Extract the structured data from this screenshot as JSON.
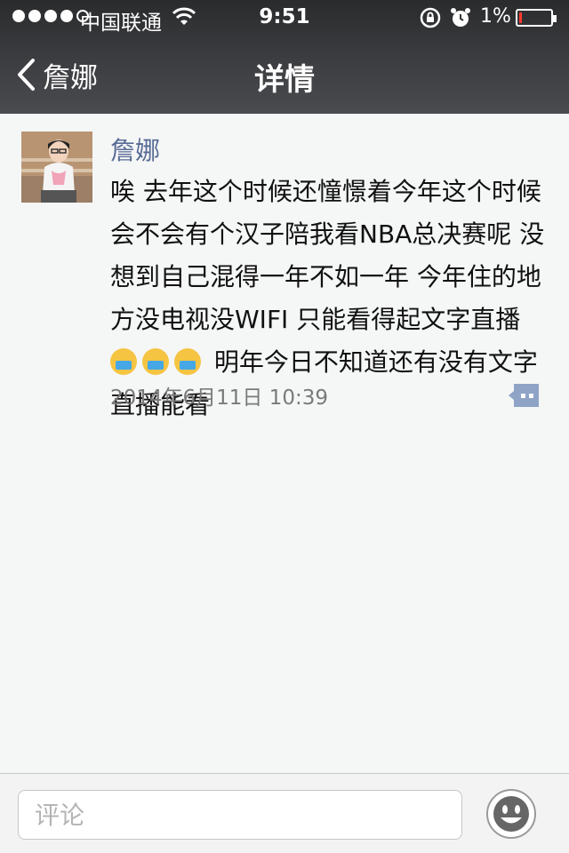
{
  "status_bar": {
    "carrier": "中国联通",
    "time": "9:51",
    "battery": "1%",
    "battery_color": "#ff3b30"
  },
  "nav": {
    "back_label": "詹娜",
    "title": "详情"
  },
  "post": {
    "author": "詹娜",
    "text_before_emoji": "唉 去年这个时候还憧憬着今年这个时候会不会有个汉子陪我看NBA总决赛呢 没想到自己混得一年不如一年 今年住的地方没电视没WIFI 只能看得起文字直播",
    "text_after_emoji": " 明年今日不知道还有没有文字直播能看",
    "emoji_icon": "crying-face-icon",
    "timestamp": "2014年6月11日 10:39",
    "author_color": "#576b95"
  },
  "comment_bar": {
    "placeholder": "评论",
    "emoji_button_icon": "smiley-icon"
  }
}
